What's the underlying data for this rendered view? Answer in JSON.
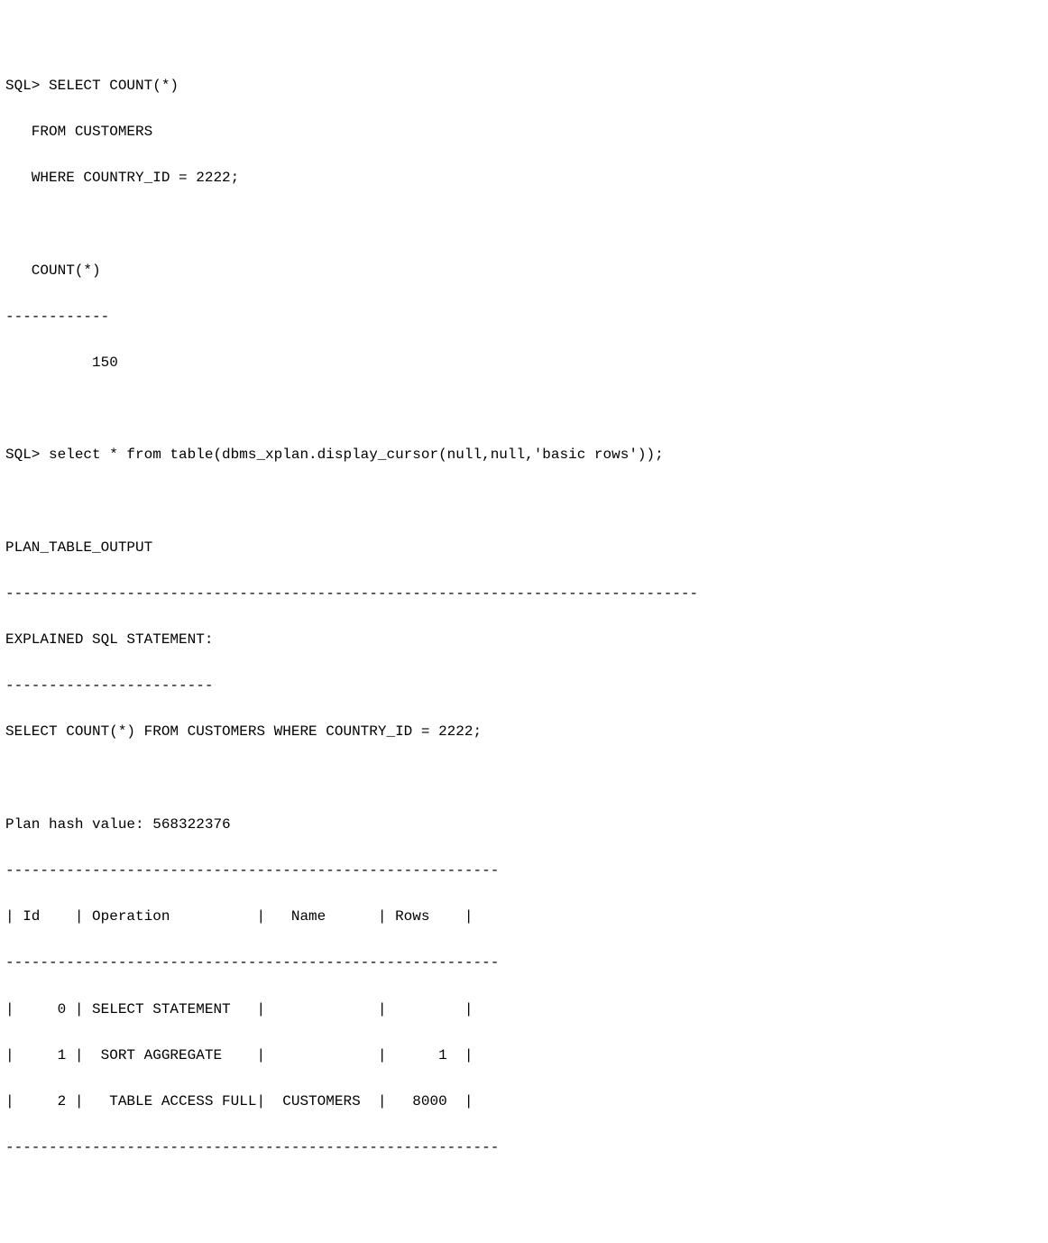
{
  "session": {
    "prompt": "SQL>",
    "query1": {
      "line1": "SQL> SELECT COUNT(*)",
      "line2": "   FROM CUSTOMERS",
      "line3": "   WHERE COUNTRY_ID = 2222;"
    },
    "result1": {
      "header": "   COUNT(*)",
      "divider": "------------",
      "value": "          150"
    },
    "query2": "SQL> select * from table(dbms_xplan.display_cursor(null,null,'basic rows'));",
    "plan": {
      "header": "PLAN_TABLE_OUTPUT",
      "divider_long": "--------------------------------------------------------------------------------",
      "explained_label": "EXPLAINED SQL STATEMENT:",
      "explained_divider": "------------------------",
      "explained_sql": "SELECT COUNT(*) FROM CUSTOMERS WHERE COUNTRY_ID = 2222;",
      "hash_label": "Plan hash value: 568322376",
      "table_divider": "---------------------------------------------------------",
      "columns_row": "| Id    | Operation          |   Name      | Rows    |",
      "rows": [
        "|     0 | SELECT STATEMENT   |             |         |",
        "|     1 |  SORT AGGREGATE    |             |      1  |",
        "|     2 |   TABLE ACCESS FULL|  CUSTOMERS  |   8000  |"
      ]
    }
  },
  "chart_data": {
    "type": "table",
    "title": "PLAN_TABLE_OUTPUT",
    "plan_hash_value": 568322376,
    "explained_sql": "SELECT COUNT(*) FROM CUSTOMERS WHERE COUNTRY_ID = 2222;",
    "columns": [
      "Id",
      "Operation",
      "Name",
      "Rows"
    ],
    "rows": [
      {
        "Id": 0,
        "Operation": "SELECT STATEMENT",
        "Name": "",
        "Rows": null
      },
      {
        "Id": 1,
        "Operation": "SORT AGGREGATE",
        "Name": "",
        "Rows": 1
      },
      {
        "Id": 2,
        "Operation": "TABLE ACCESS FULL",
        "Name": "CUSTOMERS",
        "Rows": 8000
      }
    ],
    "query_result": {
      "COUNT(*)": 150
    }
  }
}
